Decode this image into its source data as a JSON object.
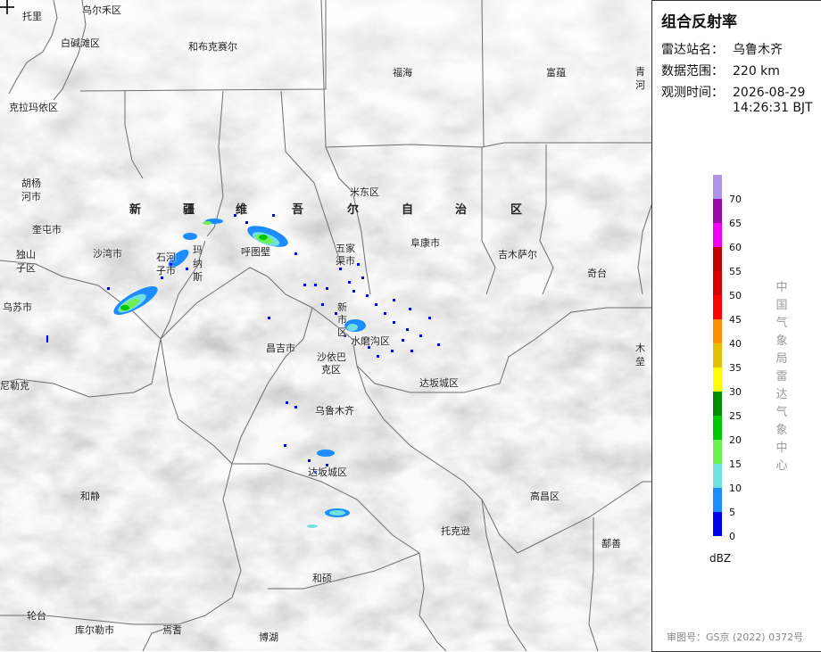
{
  "panel": {
    "title": "组合反射率",
    "station_label": "雷达站名：",
    "station_value": "乌鲁木齐",
    "range_label": "数据范围：",
    "range_value": "220 km",
    "time_label": "观测时间：",
    "time_date": "2026-08-29",
    "time_clock": "14:26:31 BJT",
    "unit": "dBZ",
    "organization_chars": [
      "中",
      "国",
      "气",
      "象",
      "局",
      "雷",
      "达",
      "气",
      "象",
      "中",
      "心"
    ],
    "approval": "审图号：GS京 (2022) 0372号"
  },
  "legend": [
    {
      "value": "70",
      "color": "#b094e6"
    },
    {
      "value": "65",
      "color": "#9a0aa6"
    },
    {
      "value": "60",
      "color": "#f000f0"
    },
    {
      "value": "55",
      "color": "#c00000"
    },
    {
      "value": "50",
      "color": "#d60000"
    },
    {
      "value": "45",
      "color": "#ff0000"
    },
    {
      "value": "40",
      "color": "#ff9000"
    },
    {
      "value": "35",
      "color": "#e6c000"
    },
    {
      "value": "30",
      "color": "#ffff00"
    },
    {
      "value": "25",
      "color": "#008c00"
    },
    {
      "value": "20",
      "color": "#00c800"
    },
    {
      "value": "15",
      "color": "#70f050"
    },
    {
      "value": "10",
      "color": "#70e0e0"
    },
    {
      "value": "5",
      "color": "#1c8cff"
    },
    {
      "value": "0",
      "color": "#0000f0"
    }
  ],
  "map": {
    "region_chars": [
      "新",
      "疆",
      "维",
      "吾",
      "尔",
      "自",
      "治",
      "区"
    ],
    "places": {
      "tuoli": "托里",
      "wuerhe": "乌尔禾区",
      "baijiantan": "白碱滩区",
      "hebukesaier": "和布克赛尔",
      "fuhai": "福海",
      "fuyun": "富蕴",
      "qinghe_a": "青",
      "qinghe_b": "河",
      "kelamayi": "克拉玛依区",
      "huyanghe_a": "胡杨",
      "huyanghe_b": "河市",
      "kuitun": "奎屯市",
      "dushanzi_a": "独山",
      "dushanzi_b": "子区",
      "shawan": "沙湾市",
      "shihezi_a": "石河",
      "shihezi_b": "子市",
      "manas_a": "玛",
      "manas_b": "纳",
      "manas_c": "斯",
      "hutubi": "呼图壁",
      "wujiaqu_a": "五家",
      "wujiaqu_b": "渠市",
      "midong": "米东区",
      "fukang": "阜康市",
      "jimusaer": "吉木萨尔",
      "qitai": "奇台",
      "wusu": "乌苏市",
      "xinshi_a": "新",
      "xinshi_b": "市",
      "xinshi_c": "区",
      "shuimogou": "水磨沟区",
      "changji": "昌吉市",
      "shayibake_a": "沙依巴",
      "shayibake_b": "克区",
      "muleiE_a": "木",
      "muleiE_b": "垒",
      "nileke": "尼勒克",
      "dabancheng_1": "达坂城区",
      "wulumuqi": "乌鲁木齐",
      "dabancheng_2": "达坂城区",
      "hejing": "和静",
      "gaochang": "高昌区",
      "tuokexun": "托克逊",
      "shanshan": "鄯善",
      "heshuo": "和硕",
      "luntai": "轮台",
      "kuerle": "库尔勒市",
      "yanqi": "焉耆",
      "bohu": "博湖"
    }
  }
}
